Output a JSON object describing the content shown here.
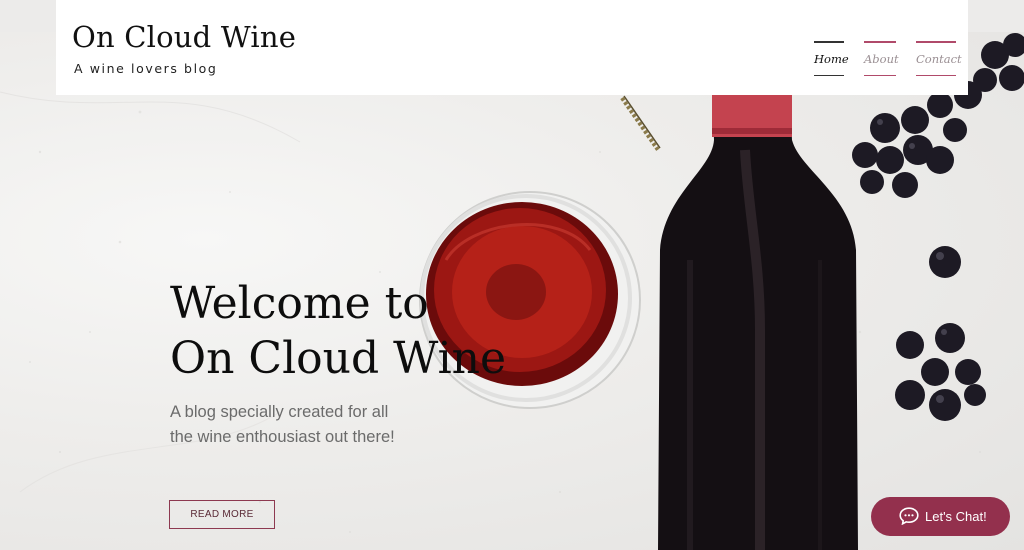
{
  "header": {
    "title": "On Cloud Wine",
    "tagline": "A wine lovers blog",
    "nav": [
      {
        "label": "Home",
        "active": true
      },
      {
        "label": "About",
        "active": false
      },
      {
        "label": "Contact",
        "active": false
      }
    ]
  },
  "hero": {
    "title_line1": "Welcome to",
    "title_line2": "On Cloud Wine",
    "subtitle": "A blog specially created for all the wine enthousiast out there!",
    "cta_label": "READ MORE",
    "image": {
      "objects": [
        "wine-glass-icon",
        "wine-bottle-icon",
        "grapes-icon",
        "corkscrew-icon"
      ]
    }
  },
  "chat": {
    "label": "Let's Chat!",
    "icon": "chat-bubble-icon"
  },
  "colors": {
    "accent": "#93304d",
    "nav_active": "#333333",
    "nav_inactive": "#b04a6a",
    "header_bg": "#ffffff"
  }
}
